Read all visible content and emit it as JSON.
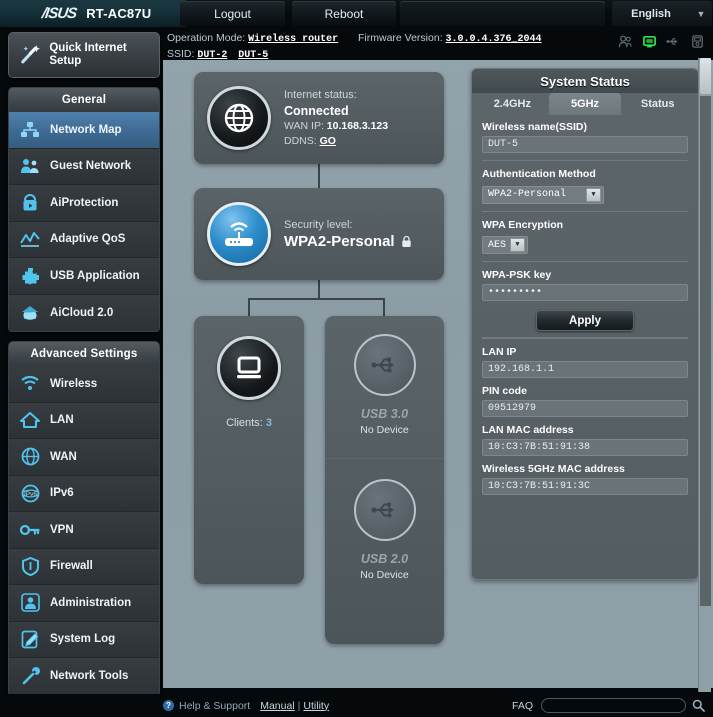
{
  "header": {
    "brand": "/ISUS",
    "model": "RT-AC87U",
    "tabs": [
      {
        "label": "Logout"
      },
      {
        "label": "Reboot"
      }
    ],
    "language": "English",
    "language_caret": "▼"
  },
  "opbar": {
    "operation_mode_label": "Operation Mode:",
    "operation_mode_value": "Wireless router",
    "firmware_label": "Firmware Version:",
    "firmware_value": "3.0.0.4.376_2044",
    "ssid_label": "SSID:",
    "ssid_values": [
      "DUT-2",
      "DUT-5"
    ],
    "status_icons": [
      "users-icon",
      "network-monitor-icon",
      "usb-icon",
      "printer-icon"
    ]
  },
  "sidebar": {
    "quick_setup": "Quick Internet Setup",
    "general_header": "General",
    "general_items": [
      {
        "label": "Network Map",
        "icon": "network-map-icon",
        "active": true
      },
      {
        "label": "Guest Network",
        "icon": "guest-network-icon",
        "active": false
      },
      {
        "label": "AiProtection",
        "icon": "shield-lock-icon",
        "active": false
      },
      {
        "label": "Adaptive QoS",
        "icon": "qos-chart-icon",
        "active": false
      },
      {
        "label": "USB Application",
        "icon": "puzzle-icon",
        "active": false
      },
      {
        "label": "AiCloud 2.0",
        "icon": "cloud-home-icon",
        "active": false
      }
    ],
    "advanced_header": "Advanced Settings",
    "advanced_items": [
      {
        "label": "Wireless",
        "icon": "wifi-icon"
      },
      {
        "label": "LAN",
        "icon": "home-icon"
      },
      {
        "label": "WAN",
        "icon": "globe-icon"
      },
      {
        "label": "IPv6",
        "icon": "ipv6-icon"
      },
      {
        "label": "VPN",
        "icon": "vpn-key-icon"
      },
      {
        "label": "Firewall",
        "icon": "firewall-shield-icon"
      },
      {
        "label": "Administration",
        "icon": "admin-user-icon"
      },
      {
        "label": "System Log",
        "icon": "system-log-icon"
      },
      {
        "label": "Network Tools",
        "icon": "network-tools-icon"
      }
    ]
  },
  "network_map": {
    "internet": {
      "status_label": "Internet status:",
      "status_value": "Connected",
      "wan_ip_label": "WAN IP:",
      "wan_ip_value": "10.168.3.123",
      "ddns_label": "DDNS:",
      "ddns_value": "GO"
    },
    "router": {
      "security_label": "Security level:",
      "security_value": "WPA2-Personal",
      "lock_icon": "lock-icon"
    },
    "clients": {
      "label": "Clients:",
      "count": "3"
    },
    "usb_slots": [
      {
        "name": "USB 3.0",
        "state": "No Device"
      },
      {
        "name": "USB 2.0",
        "state": "No Device"
      }
    ]
  },
  "system_status": {
    "title": "System Status",
    "tabs": [
      {
        "label": "2.4GHz",
        "active": false
      },
      {
        "label": "5GHz",
        "active": true
      },
      {
        "label": "Status",
        "active": false
      }
    ],
    "fields": [
      {
        "label": "Wireless name(SSID)",
        "value": "DUT-5"
      }
    ],
    "auth_label": "Authentication Method",
    "auth_value": "WPA2-Personal",
    "encryption_label": "WPA Encryption",
    "encryption_value": "AES",
    "psk_label": "WPA-PSK key",
    "psk_value": "•••••••••",
    "apply_label": "Apply",
    "info_fields": [
      {
        "label": "LAN IP",
        "value": "192.168.1.1"
      },
      {
        "label": "PIN code",
        "value": "09512979"
      },
      {
        "label": "LAN MAC address",
        "value": "10:C3:7B:51:91:38"
      },
      {
        "label": "Wireless 5GHz MAC address",
        "value": "10:C3:7B:51:91:3C"
      }
    ],
    "caret": "▼"
  },
  "footer": {
    "help_mark": "?",
    "help_text": "Help & Support",
    "manual": "Manual",
    "pipe": "|",
    "utility": "Utility",
    "faq_label": "FAQ",
    "search_icon": "search-icon"
  }
}
